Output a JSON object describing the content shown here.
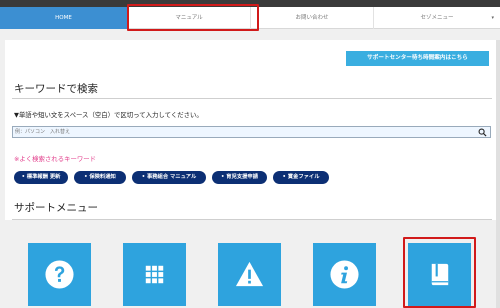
{
  "nav": {
    "tabs": [
      {
        "label": "HOME",
        "active": true
      },
      {
        "label": "マニュアル",
        "active": false
      },
      {
        "label": "お問い合わせ",
        "active": false
      },
      {
        "label": "セゾメニュー",
        "active": false
      }
    ]
  },
  "support_button": {
    "label": "サポートセンター待ち時間案内はこちら"
  },
  "keyword_section": {
    "title": "キーワードで検索",
    "instruction": "▼単語や短い文をスペース（空白）で区切って入力してください。",
    "search_placeholder": "例：パソコン　入れ替え",
    "popular_label": "※よく検索されるキーワード",
    "tags": [
      "標準報酬 更新",
      "保険料通知",
      "事務組合 マニュアル",
      "育児支援申請",
      "賞金ファイル"
    ]
  },
  "support_menu": {
    "title": "サポートメニュー",
    "tiles": [
      {
        "icon": "question-icon"
      },
      {
        "icon": "grid-icon"
      },
      {
        "icon": "warning-icon"
      },
      {
        "icon": "info-icon"
      },
      {
        "icon": "book-icon"
      }
    ]
  },
  "colors": {
    "nav_active": "#3c8fd2",
    "support_button": "#3aaee0",
    "tag_bg": "#0c2f74",
    "tile_bg": "#2ea3de",
    "popular_label": "#e23d8b",
    "highlight": "#d11a1a"
  }
}
